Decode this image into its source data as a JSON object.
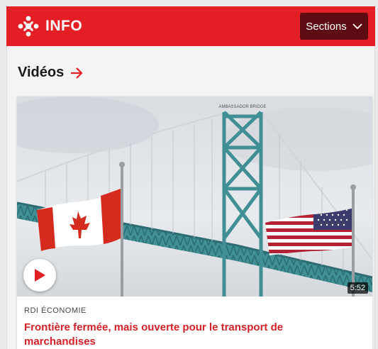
{
  "header": {
    "logo_text": "INFO",
    "sections_label": "Sections"
  },
  "section": {
    "title": "Vidéos"
  },
  "video_card": {
    "duration": "5:52",
    "kicker": "RDI ÉCONOMIE",
    "headline": "Frontière fermée, mais ouverte pour le transport de marchandises",
    "bridge_sign": "AMBASSADOR BRIDGE"
  },
  "colors": {
    "brand_red": "#e31e24",
    "sections_button": "#5c0c12",
    "headline_red": "#d61f26"
  },
  "icons": {
    "logo": "cbc-gem-icon",
    "sections_chevron": "chevron-down-icon",
    "title_arrow": "arrow-right-icon",
    "play": "play-icon"
  }
}
